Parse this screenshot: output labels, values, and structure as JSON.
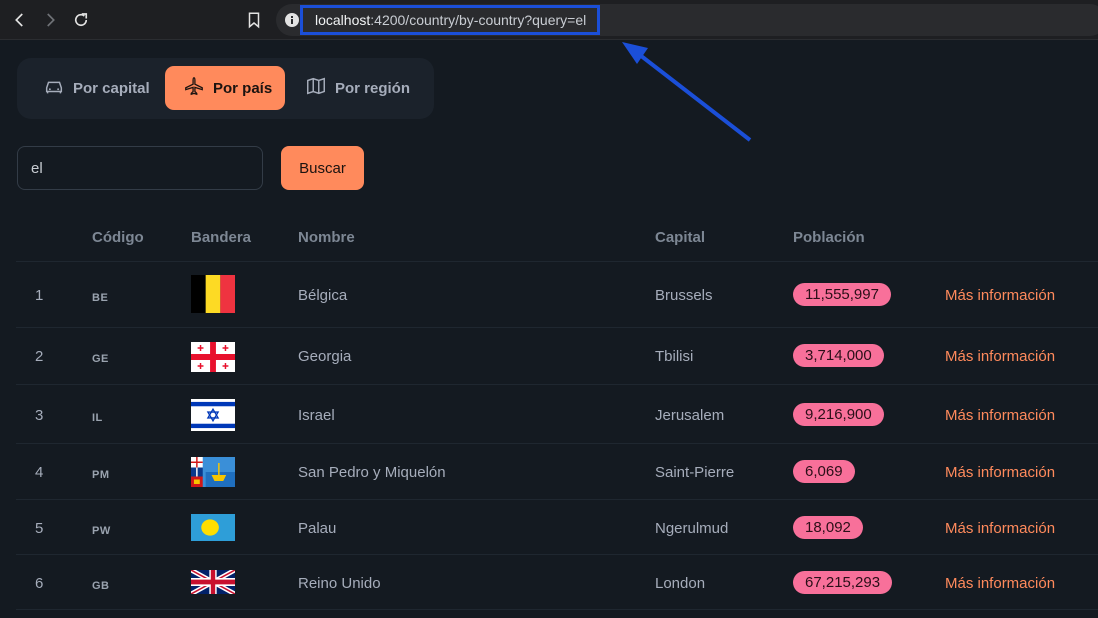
{
  "browser": {
    "url_host": "localhost",
    "url_rest": ":4200/country/by-country?query=el",
    "icons": [
      "back-icon",
      "forward-icon",
      "reload-icon",
      "bookmark-icon",
      "info-icon"
    ]
  },
  "tabs": [
    {
      "label": "Por capital",
      "icon": "car-icon",
      "active": false
    },
    {
      "label": "Por país",
      "icon": "plane-icon",
      "active": true
    },
    {
      "label": "Por región",
      "icon": "map-icon",
      "active": false
    }
  ],
  "search": {
    "value": "el",
    "button_label": "Buscar"
  },
  "table": {
    "headers": {
      "code": "Código",
      "flag": "Bandera",
      "name": "Nombre",
      "capital": "Capital",
      "population": "Población"
    },
    "rows": [
      {
        "index": "1",
        "code": "BE",
        "name": "Bélgica",
        "capital": "Brussels",
        "population": "11,555,997",
        "more": "Más información"
      },
      {
        "index": "2",
        "code": "GE",
        "name": "Georgia",
        "capital": "Tbilisi",
        "population": "3,714,000",
        "more": "Más información"
      },
      {
        "index": "3",
        "code": "IL",
        "name": "Israel",
        "capital": "Jerusalem",
        "population": "9,216,900",
        "more": "Más información"
      },
      {
        "index": "4",
        "code": "PM",
        "name": "San Pedro y Miquelón",
        "capital": "Saint-Pierre",
        "population": "6,069",
        "more": "Más información"
      },
      {
        "index": "5",
        "code": "PW",
        "name": "Palau",
        "capital": "Ngerulmud",
        "population": "18,092",
        "more": "Más información"
      },
      {
        "index": "6",
        "code": "GB",
        "name": "Reino Unido",
        "capital": "London",
        "population": "67,215,293",
        "more": "Más información"
      }
    ]
  },
  "colors": {
    "accent": "#ff8a5c",
    "badge": "#f8709a",
    "highlight": "#1b4fd8",
    "background": "#141a21"
  }
}
